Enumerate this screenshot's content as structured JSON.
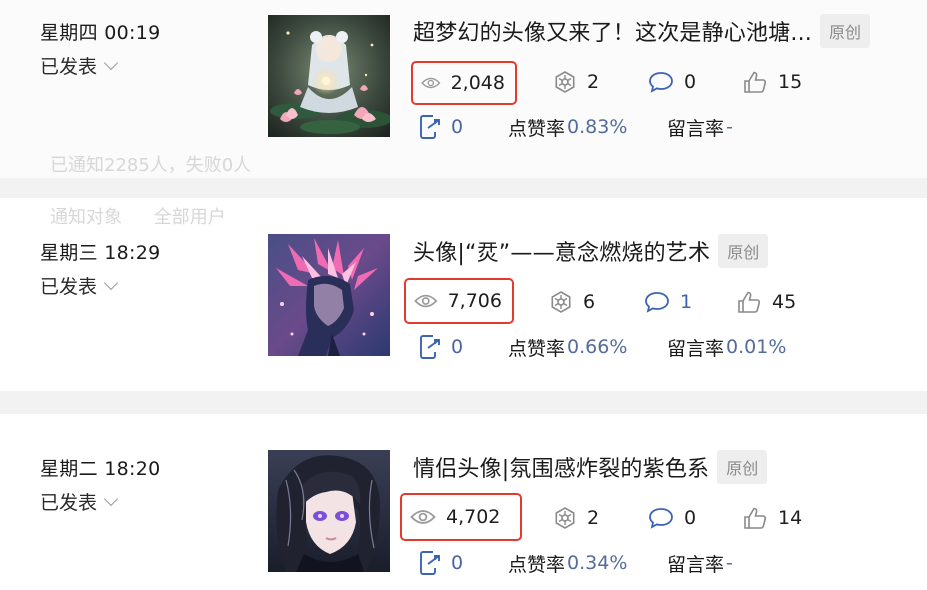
{
  "colors": {
    "accent_link": "#546c9a",
    "highlight_border": "#e23a2f",
    "icon_blue": "#3c64b4"
  },
  "background_overlay": {
    "notify_line": "已通知2285人，失败0人",
    "target_label": "通知对象",
    "target_value": "全部用户"
  },
  "posts": [
    {
      "date": "星期四 00:19",
      "status": "已发表",
      "title": "超梦幻的头像又来了！这次是静心池塘...",
      "badge": "原创",
      "views": "2,048",
      "shares": "2",
      "comments": "0",
      "likes": "15",
      "forwards": "0",
      "like_rate_label": "点赞率",
      "like_rate": "0.83%",
      "comment_rate_label": "留言率",
      "comment_rate": "-",
      "thumb_theme": "lotus-pond-girl"
    },
    {
      "date": "星期三 18:29",
      "status": "已发表",
      "title": "头像|“烎”——意念燃烧的艺术",
      "badge": "原创",
      "views": "7,706",
      "shares": "6",
      "comments": "1",
      "likes": "45",
      "forwards": "0",
      "like_rate_label": "点赞率",
      "like_rate": "0.66%",
      "comment_rate_label": "留言率",
      "comment_rate": "0.01%",
      "thumb_theme": "pink-burning-profile"
    },
    {
      "date": "星期二 18:20",
      "status": "已发表",
      "title": "情侣头像|氛围感炸裂的紫色系",
      "badge": "原创",
      "views": "4,702",
      "shares": "2",
      "comments": "0",
      "likes": "14",
      "forwards": "0",
      "like_rate_label": "点赞率",
      "like_rate": "0.34%",
      "comment_rate_label": "留言率",
      "comment_rate": "-",
      "thumb_theme": "purple-eyed-portrait"
    }
  ],
  "icons": {
    "views": "eye-icon",
    "shares": "share-icon",
    "comments": "comment-icon",
    "likes": "thumbs-up-icon",
    "forwards": "forward-icon",
    "status": "chevron-down-icon"
  }
}
